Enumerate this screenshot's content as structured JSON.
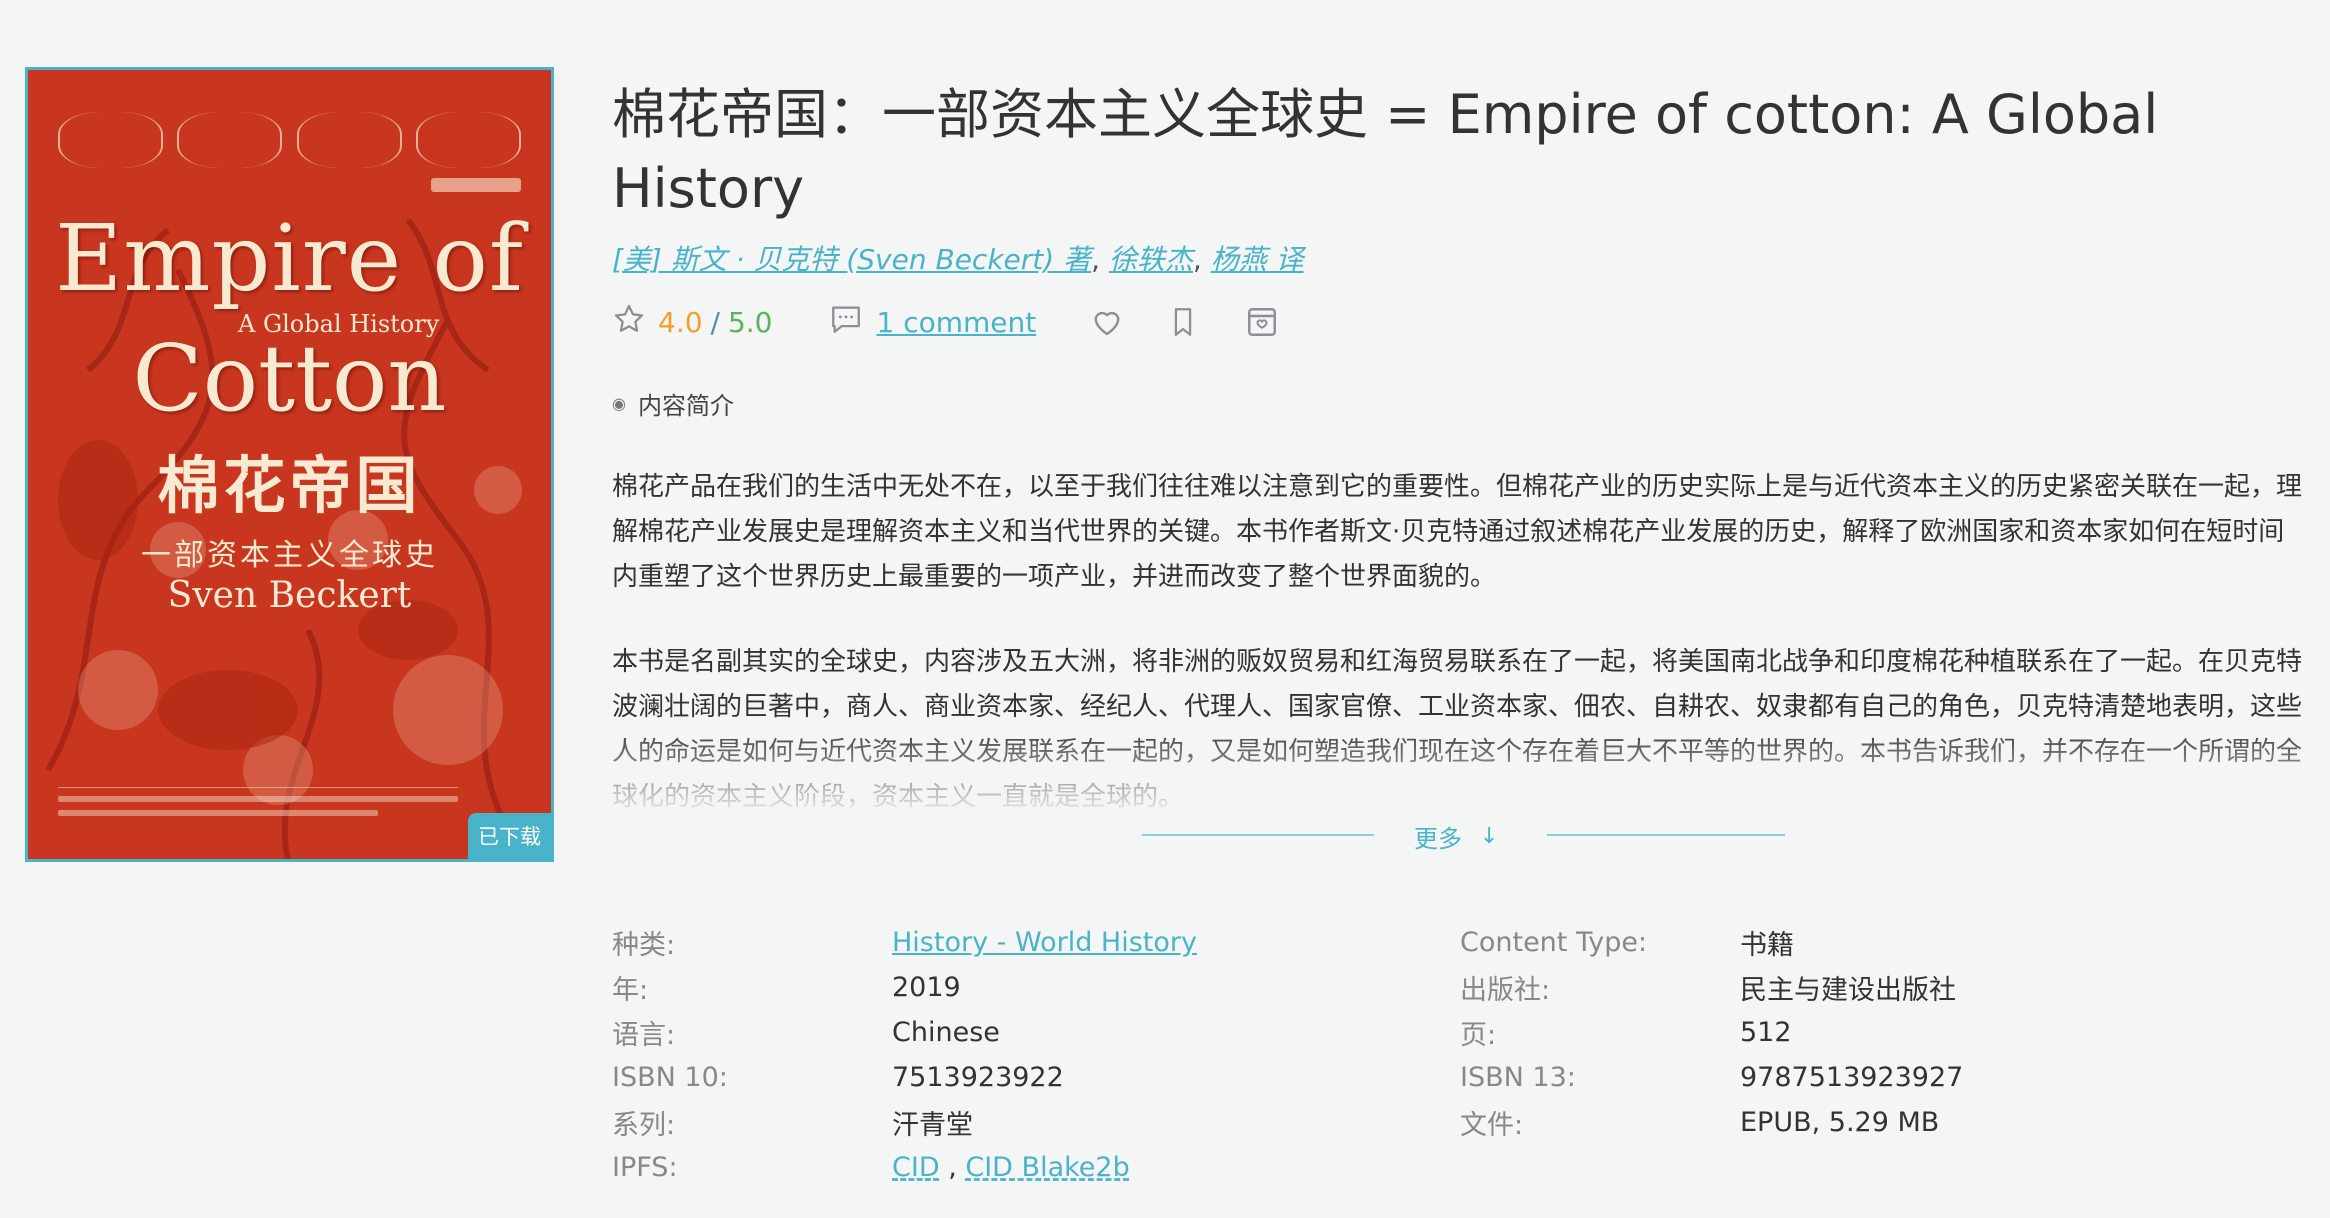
{
  "book": {
    "title": "棉花帝国：一部资本主义全球史 = Empire of cotton: A Global History",
    "authors": [
      {
        "label": "[美] 斯文 · 贝克特 (Sven Beckert) 著"
      },
      {
        "label": "徐轶杰"
      },
      {
        "label": "杨燕 译"
      }
    ],
    "author_separator": ", ",
    "rating_value": "4.0",
    "rating_separator": "/",
    "rating_max": "5.0",
    "comment_label": "1 comment",
    "downloaded_badge": "已下载",
    "icons": [
      "star-icon",
      "comment-icon",
      "heart-icon",
      "bookmark-icon",
      "inbox-icon"
    ]
  },
  "cover": {
    "title_line1": "Empire of",
    "subtitle": "A Global History",
    "title_line2": "Cotton",
    "title_zh": "棉花帝国",
    "subtitle_zh": "一部资本主义全球史",
    "author": "Sven Beckert"
  },
  "description": {
    "section_label": "内容简介",
    "paragraphs": [
      "棉花产品在我们的生活中无处不在，以至于我们往往难以注意到它的重要性。但棉花产业的历史实际上是与近代资本主义的历史紧密关联在一起，理解棉花产业发展史是理解资本主义和当代世界的关键。本书作者斯文·贝克特通过叙述棉花产业发展的历史，解释了欧洲国家和资本家如何在短时间内重塑了这个世界历史上最重要的一项产业，并进而改变了整个世界面貌的。",
      "本书是名副其实的全球史，内容涉及五大洲，将非洲的贩奴贸易和红海贸易联系在了一起，将美国南北战争和印度棉花种植联系在了一起。在贝克特波澜壮阔的巨著中，商人、商业资本家、经纪人、代理人、国家官僚、工业资本家、佃农、自耕农、奴隶都有自己的角色，贝克特清楚地表明，这些人的命运是如何与近代资本主义发展联系在一起的，又是如何塑造我们现在这个存在着巨大不平等的世界的。本书告诉我们，并不存在一个所谓的全球化的资本主义阶段，资本主义一直就是全球的。"
    ],
    "more_label": "更多",
    "more_arrow": "↓"
  },
  "details": {
    "rows": [
      {
        "label": "种类:",
        "value": "History - World History",
        "label2": "Content Type:",
        "value2": "书籍"
      },
      {
        "label": "年:",
        "value": "2019",
        "label2": "出版社:",
        "value2": "民主与建设出版社"
      },
      {
        "label": "语言:",
        "value": "Chinese",
        "label2": "页:",
        "value2": "512"
      },
      {
        "label": "ISBN 10:",
        "value": "7513923922",
        "label2": "ISBN 13:",
        "value2": "9787513923927"
      },
      {
        "label": "系列:",
        "value": "汗青堂",
        "label2": "文件:",
        "value2": "EPUB, 5.29 MB"
      }
    ],
    "ipfs_label": "IPFS:",
    "ipfs_links": [
      "CID",
      "CID Blake2b"
    ],
    "ipfs_separator": " , "
  }
}
